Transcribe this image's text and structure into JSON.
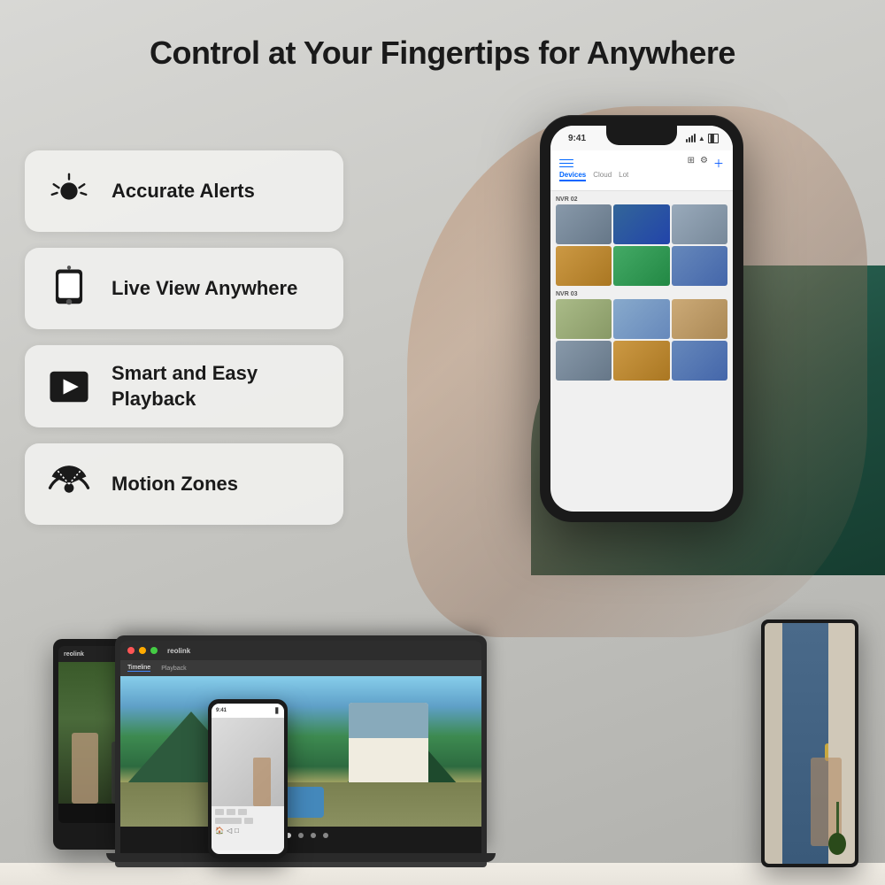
{
  "page": {
    "background_color": "#d8d6d2"
  },
  "header": {
    "title": "Control at Your Fingertips for Anywhere"
  },
  "features": [
    {
      "id": "accurate-alerts",
      "icon": "alert-bell-icon",
      "label": "Accurate Alerts"
    },
    {
      "id": "live-view",
      "icon": "mobile-camera-icon",
      "label": "Live View Anywhere"
    },
    {
      "id": "smart-playback",
      "icon": "play-screen-icon",
      "label": "Smart and Easy Playback"
    },
    {
      "id": "motion-zones",
      "icon": "motion-sensor-icon",
      "label": "Motion Zones"
    }
  ],
  "phone": {
    "status_time": "9:41",
    "tabs": [
      "Devices",
      "Cloud",
      "Lot"
    ],
    "active_tab": "Devices",
    "sections": [
      {
        "label": "NVR 02"
      },
      {
        "label": "NVR 03"
      }
    ]
  },
  "laptop": {
    "brand": "reolink",
    "tabs": [
      "Timeline",
      "Playback"
    ],
    "active_tab": "Timeline"
  },
  "tablet": {
    "brand": "reolink"
  },
  "devices_label": "reolink"
}
